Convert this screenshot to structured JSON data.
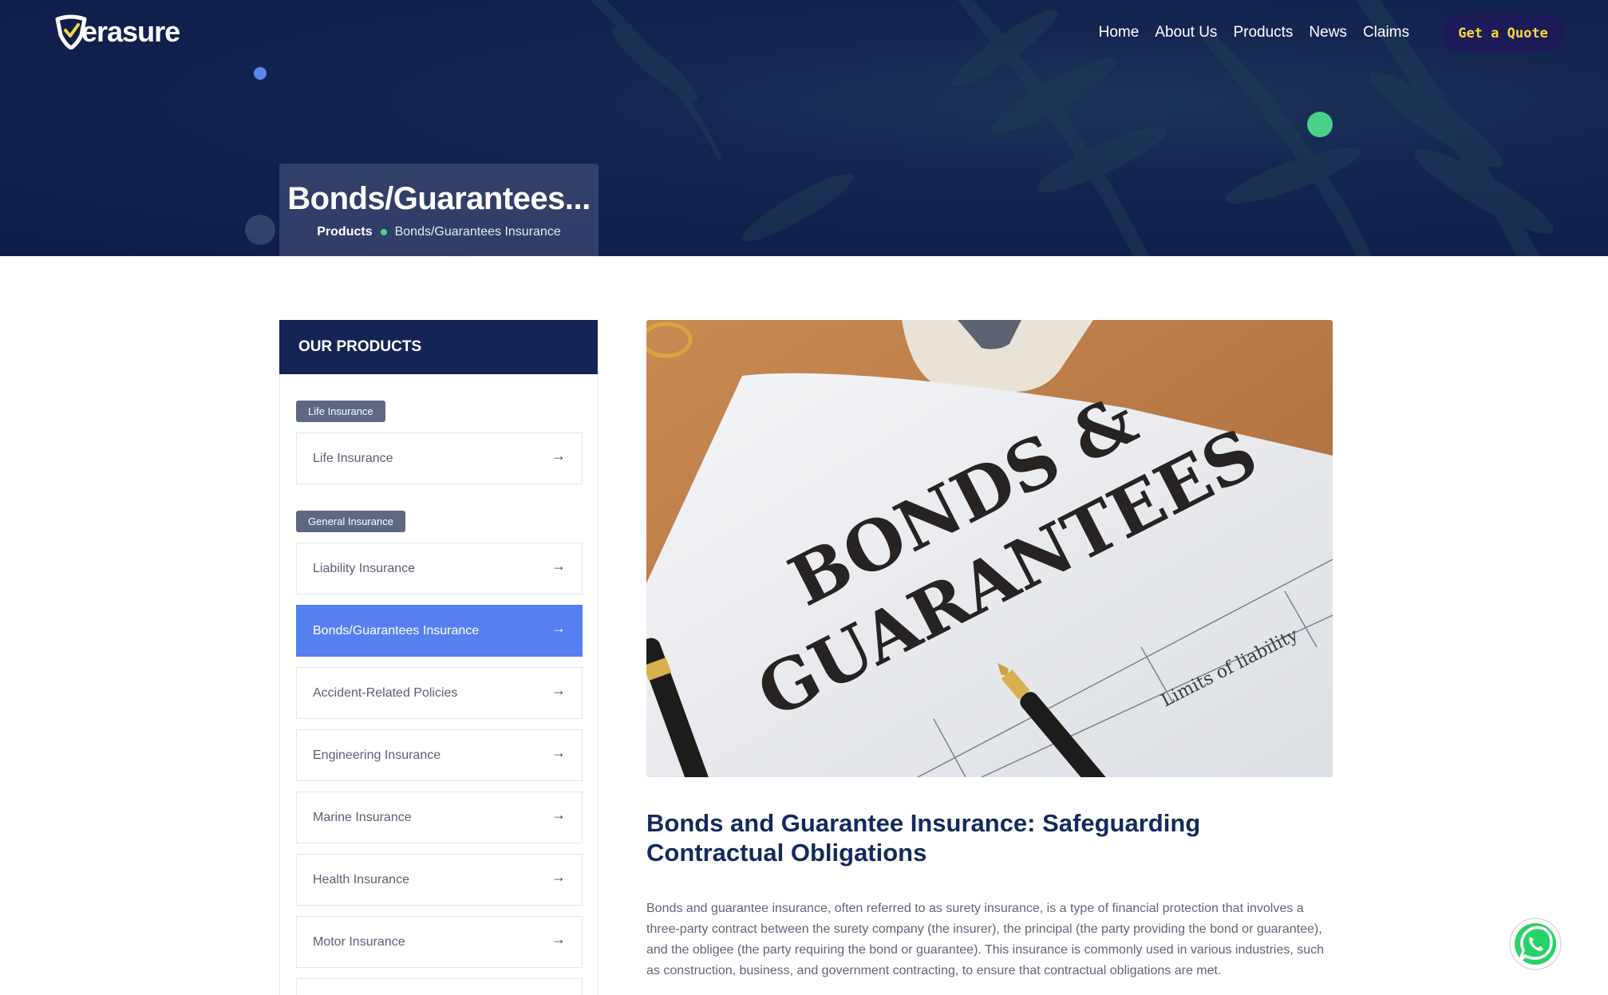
{
  "brand": {
    "name": "erasure"
  },
  "nav": {
    "items": [
      "Home",
      "About Us",
      "Products",
      "News",
      "Claims"
    ],
    "cta": "Get a Quote"
  },
  "hero": {
    "title": "Bonds/Guarantees...",
    "breadcrumb": {
      "parent": "Products",
      "current": "Bonds/Guarantees Insurance"
    }
  },
  "sidebar": {
    "heading": "OUR PRODUCTS",
    "groups": [
      {
        "tag": "Life Insurance",
        "items": [
          "Life Insurance"
        ]
      },
      {
        "tag": "General Insurance",
        "items": [
          "Liability Insurance",
          "Bonds/Guarantees Insurance",
          "Accident-Related Policies",
          "Engineering Insurance",
          "Marine Insurance",
          "Health Insurance",
          "Motor Insurance"
        ]
      }
    ],
    "active_item": "Bonds/Guarantees Insurance"
  },
  "feature_image": {
    "line1": "BONDS &",
    "line2": "GUARANTEES",
    "form_label": "Limits of liability"
  },
  "content": {
    "title": "Bonds and Guarantee Insurance: Safeguarding Contractual Obligations",
    "body": "Bonds and guarantee insurance, often referred to as surety insurance, is a type of financial protection that involves a three-party contract between the surety company (the insurer), the principal (the party providing the bond or guarantee), and the obligee (the party requiring the bond or guarantee). This insurance is commonly used in various industries, such as construction, business, and government contracting, to ensure that contractual obligations are met."
  },
  "colors": {
    "navy": "#142455",
    "accent_blue": "#567ff0",
    "accent_green": "#48d18a",
    "cta_text": "#f5d93a",
    "whatsapp": "#25d366"
  },
  "icons": [
    "logo-shield-icon",
    "arrow-right-icon",
    "whatsapp-icon"
  ]
}
